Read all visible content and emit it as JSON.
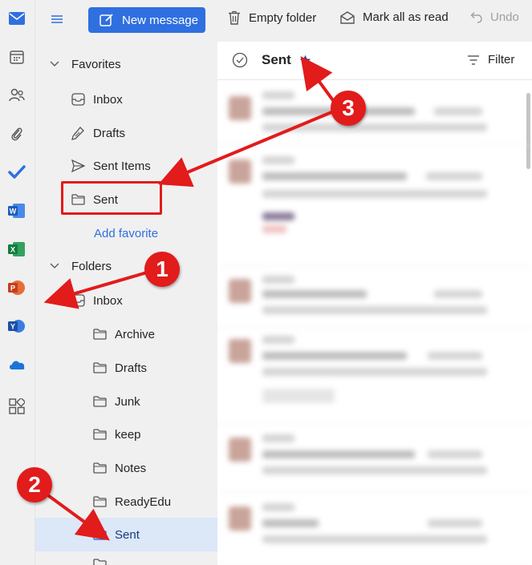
{
  "toolbar": {
    "new_message": "New message",
    "empty_folder": "Empty folder",
    "mark_all_read": "Mark all as read",
    "undo": "Undo"
  },
  "folder_pane": {
    "favorites_heading": "Favorites",
    "favorites": [
      {
        "label": "Inbox",
        "icon": "inbox-icon"
      },
      {
        "label": "Drafts",
        "icon": "pencil-icon"
      },
      {
        "label": "Sent Items",
        "icon": "send-icon"
      },
      {
        "label": "Sent",
        "icon": "folder-icon"
      }
    ],
    "add_favorite": "Add favorite",
    "folders_heading": "Folders",
    "inbox_label": "Inbox",
    "subfolders": [
      "Archive",
      "Drafts",
      "Junk",
      "keep",
      "Notes",
      "ReadyEdu",
      "Sent"
    ]
  },
  "list": {
    "title": "Sent",
    "filter": "Filter"
  },
  "annotations": {
    "badge1": "1",
    "badge2": "2",
    "badge3": "3"
  },
  "colors": {
    "accent": "#2f6fe0",
    "annotation_red": "#e21b1b",
    "selected_bg": "#dce7f7"
  }
}
